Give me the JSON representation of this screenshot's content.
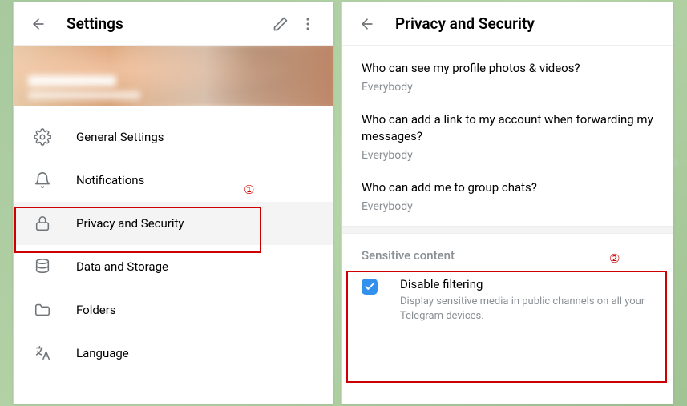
{
  "settings": {
    "title": "Settings",
    "menu": [
      {
        "icon": "gear",
        "label": "General Settings"
      },
      {
        "icon": "bell",
        "label": "Notifications"
      },
      {
        "icon": "lock",
        "label": "Privacy and Security"
      },
      {
        "icon": "database",
        "label": "Data and Storage"
      },
      {
        "icon": "folder",
        "label": "Folders"
      },
      {
        "icon": "language",
        "label": "Language"
      }
    ]
  },
  "privacy": {
    "title": "Privacy and Security",
    "items": [
      {
        "label": "Who can see my profile photos & videos?",
        "value": "Everybody"
      },
      {
        "label": "Who can add a link to my account when forwarding my messages?",
        "value": "Everybody"
      },
      {
        "label": "Who can add me to group chats?",
        "value": "Everybody"
      }
    ],
    "sensitive": {
      "heading": "Sensitive content",
      "checkbox_label": "Disable filtering",
      "checkbox_desc": "Display sensitive media in public channels on all your Telegram devices.",
      "checked": true
    }
  },
  "annotations": {
    "one": "①",
    "two": "②"
  }
}
